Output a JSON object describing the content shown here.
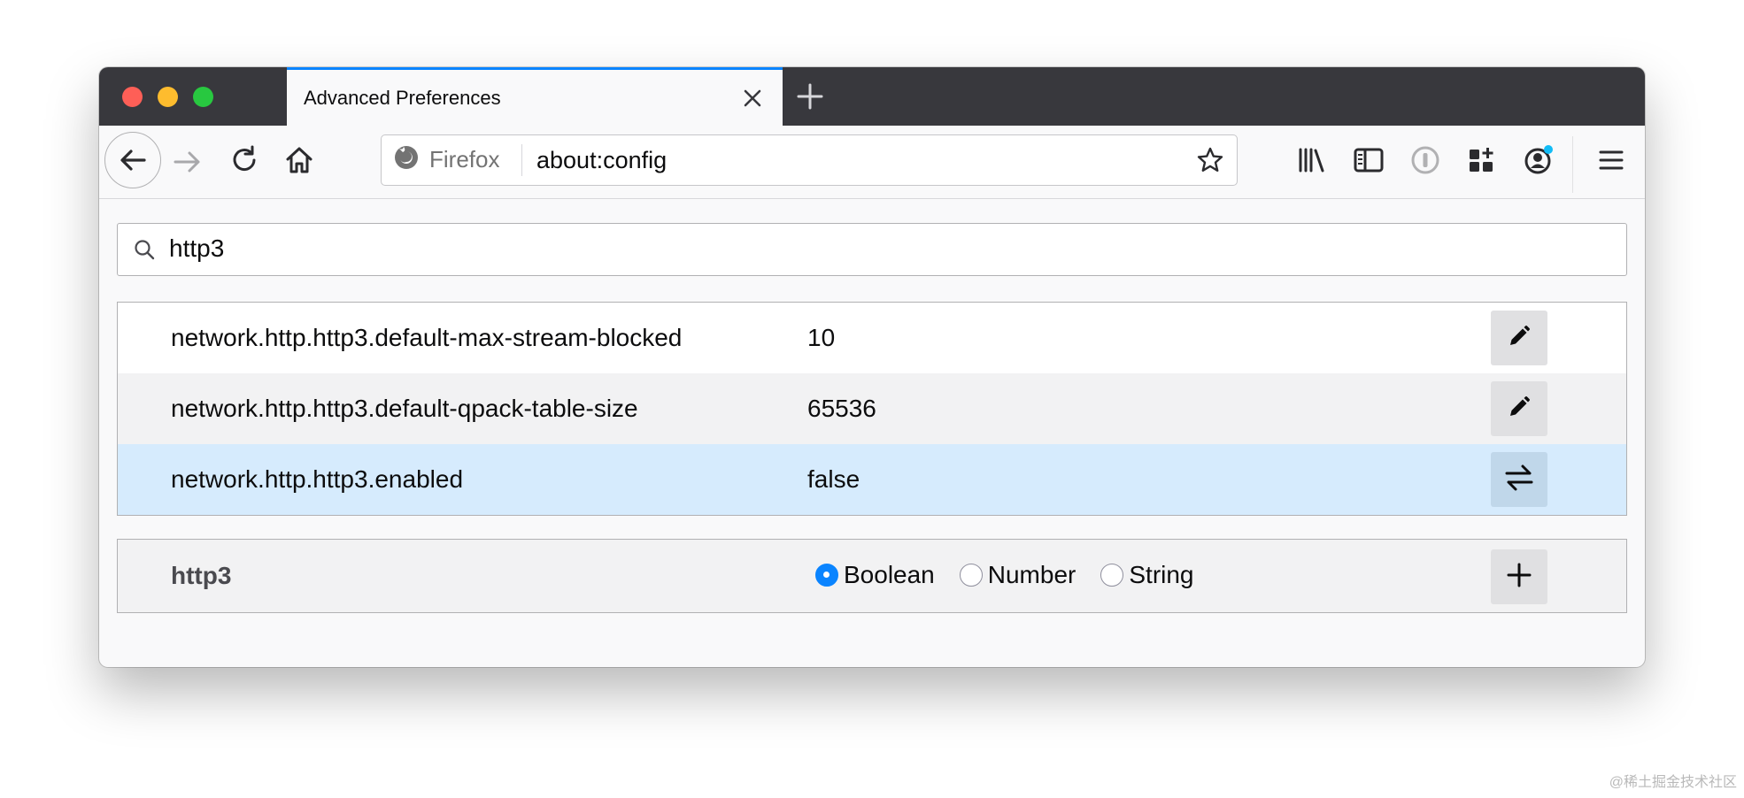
{
  "browser": {
    "tab_title": "Advanced Preferences",
    "identity_label": "Firefox",
    "url": "about:config",
    "sync_dot_color": "#12bcf6"
  },
  "search": {
    "value": "http3"
  },
  "prefs": [
    {
      "name": "network.http.http3.default-max-stream-blocked",
      "value": "10",
      "action": "edit"
    },
    {
      "name": "network.http.http3.default-qpack-table-size",
      "value": "65536",
      "action": "edit"
    },
    {
      "name": "network.http.http3.enabled",
      "value": "false",
      "action": "toggle"
    }
  ],
  "new_pref": {
    "name": "http3",
    "types": [
      {
        "label": "Boolean",
        "checked": true
      },
      {
        "label": "Number",
        "checked": false
      },
      {
        "label": "String",
        "checked": false
      }
    ]
  },
  "icons": {
    "tab_close": "close-icon",
    "new_tab": "plus-icon",
    "back": "back-arrow-icon",
    "forward": "forward-arrow-icon",
    "reload": "reload-icon",
    "home": "home-icon",
    "firefox": "firefox-logo-icon",
    "bookmark": "star-icon",
    "library": "library-icon",
    "sidebar": "sidebar-icon",
    "extension": "extension-icon",
    "containers": "containers-icon",
    "account": "account-icon",
    "menu": "hamburger-menu-icon",
    "search": "search-icon",
    "edit": "pencil-icon",
    "toggle": "toggle-arrows-icon",
    "add": "plus-icon"
  },
  "watermark": "@稀土掘金技术社区"
}
